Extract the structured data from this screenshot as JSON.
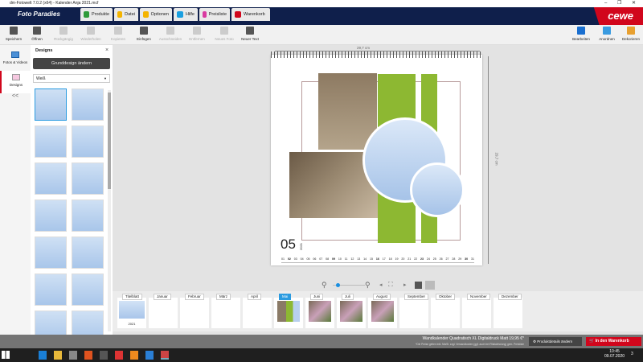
{
  "window": {
    "title": "dm-Fotowelt 7.0.2 (x64) - Kalender Anja 2021.mcf",
    "minimize": "–",
    "restore": "❐",
    "close": "✕"
  },
  "header": {
    "logo": "Foto Paradies",
    "brand": "cewe",
    "menu": [
      {
        "label": "Produkte",
        "color": "#2e9a3a"
      },
      {
        "label": "Datei",
        "color": "#f4b400"
      },
      {
        "label": "Optionen",
        "color": "#f4b400"
      },
      {
        "label": "Hilfe",
        "color": "#1a9fe0"
      },
      {
        "label": "Preisliste",
        "color": "#d93aa0"
      },
      {
        "label": "Warenkorb",
        "color": "#d1061c"
      }
    ]
  },
  "toolbar": {
    "left": [
      {
        "label": "Speichern",
        "enabled": true
      },
      {
        "label": "Öffnen",
        "enabled": true
      },
      {
        "label": "Rückgängig",
        "enabled": false
      },
      {
        "label": "Wiederholen",
        "enabled": false
      },
      {
        "label": "Kopieren",
        "enabled": false
      },
      {
        "label": "Einfügen",
        "enabled": true
      },
      {
        "label": "Ausschneiden",
        "enabled": false
      },
      {
        "label": "Entfernen",
        "enabled": false
      },
      {
        "label": "Neues Foto",
        "enabled": false
      },
      {
        "label": "Neuer Text",
        "enabled": true
      }
    ],
    "right": [
      {
        "label": "Bearbeiten"
      },
      {
        "label": "Anordnen"
      },
      {
        "label": "Dekorieren"
      }
    ]
  },
  "rail": {
    "photos": "Fotos & Videos",
    "designs": "Designs",
    "collapse": "<<"
  },
  "panel": {
    "title": "Designs",
    "close": "×",
    "button": "Grunddesign ändern",
    "select": "Weiß"
  },
  "canvas": {
    "width_label": "29,7 cm",
    "height_label": "29,7 cm",
    "month": "05",
    "year": "2021",
    "days": [
      "01",
      "02",
      "03",
      "04",
      "05",
      "06",
      "07",
      "08",
      "09",
      "10",
      "11",
      "12",
      "13",
      "14",
      "15",
      "16",
      "17",
      "18",
      "19",
      "20",
      "21",
      "22",
      "23",
      "24",
      "25",
      "26",
      "27",
      "28",
      "29",
      "30",
      "31"
    ],
    "sundays": [
      "02",
      "09",
      "16",
      "23",
      "30"
    ]
  },
  "months": [
    {
      "label": "Titelblatt",
      "sub": "2021"
    },
    {
      "label": "Januar"
    },
    {
      "label": "Februar"
    },
    {
      "label": "März"
    },
    {
      "label": "April"
    },
    {
      "label": "Mai",
      "active": true
    },
    {
      "label": "Juni"
    },
    {
      "label": "Juli"
    },
    {
      "label": "August"
    },
    {
      "label": "September"
    },
    {
      "label": "Oktober"
    },
    {
      "label": "November"
    },
    {
      "label": "Dezember"
    }
  ],
  "status": {
    "product": "Wandkalender Quadratisch XL Digitaldruck Matt 19,95 €*",
    "note": "*Die Preise gelten inkl. MwSt. zzgl. Versandkosten (ggf. auch bei Filialabholung) gem. Preisliste",
    "details_button": "Produktdetails ändern",
    "cart_button": "In den Warenkorb"
  },
  "taskbar": {
    "time": "10:45",
    "date": "09.07.2020",
    "notifications": "3"
  }
}
